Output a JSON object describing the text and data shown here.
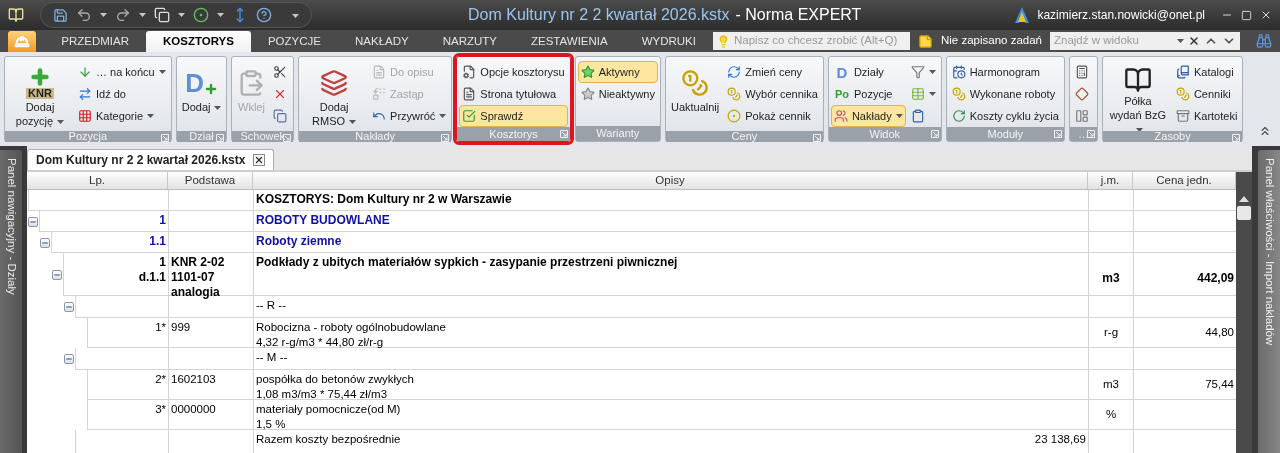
{
  "title_bar": {
    "document_name": "Dom Kultury nr 2 2 kwartał 2026.kstx",
    "app_name": "- Norma EXPERT",
    "user": "kazimierz.stan.nowicki@onet.pl"
  },
  "tabs": [
    {
      "label": "PRZEDMIAR",
      "selected": false
    },
    {
      "label": "KOSZTORYS",
      "selected": true
    },
    {
      "label": "POZYCJE",
      "selected": false
    },
    {
      "label": "NAKŁADY",
      "selected": false
    },
    {
      "label": "NARZUTY",
      "selected": false
    },
    {
      "label": "ZESTAWIENIA",
      "selected": false
    },
    {
      "label": "WYDRUKI",
      "selected": false
    }
  ],
  "tell_me": {
    "placeholder": "Napisz co chcesz zrobić (Alt+Q)"
  },
  "tasks": "Nie zapisano zadań",
  "find": {
    "placeholder": "Znajdź w widoku"
  },
  "ribbon": {
    "groups": [
      {
        "label": "Pozycja",
        "launcher": true,
        "highlighted": false,
        "items": [
          {
            "kind": "large",
            "label": "Dodaj pozycję",
            "icon_text": "KNR",
            "dropdown": true
          },
          {
            "kind": "small",
            "label": "… na końcu",
            "dropdown": true
          },
          {
            "kind": "small",
            "label": "Idź do",
            "dropdown": false
          },
          {
            "kind": "small",
            "label": "Kategorie",
            "dropdown": true
          }
        ]
      },
      {
        "label": "Dział",
        "launcher": true,
        "highlighted": false,
        "items": [
          {
            "kind": "large",
            "label": "Dodaj",
            "icon_text": "D",
            "dropdown": true
          }
        ]
      },
      {
        "label": "Schowek",
        "launcher": true,
        "highlighted": false,
        "items": [
          {
            "kind": "large",
            "label": "Wklej",
            "dropdown": false,
            "disabled": true
          },
          {
            "kind": "icon",
            "dropdown": false,
            "disabled": false
          },
          {
            "kind": "icon",
            "dropdown": false,
            "disabled": false
          },
          {
            "kind": "icon",
            "dropdown": false,
            "disabled": false
          }
        ]
      },
      {
        "label": "Nakłady",
        "launcher": true,
        "highlighted": false,
        "items": [
          {
            "kind": "large",
            "label": "Dodaj RMSO",
            "dropdown": true,
            "disabled": false
          },
          {
            "kind": "small",
            "label": "Do opisu",
            "dropdown": false,
            "disabled": true
          },
          {
            "kind": "small",
            "label": "Zastąp",
            "dropdown": false,
            "disabled": true
          },
          {
            "kind": "small",
            "label": "Przywróć",
            "dropdown": true,
            "disabled": false
          }
        ]
      },
      {
        "label": "Kosztorys",
        "launcher": true,
        "highlighted": true,
        "items": [
          {
            "kind": "small",
            "label": "Opcje kosztorysu",
            "dropdown": false,
            "active": false
          },
          {
            "kind": "small",
            "label": "Strona tytułowa",
            "dropdown": false,
            "active": false
          },
          {
            "kind": "small",
            "label": "Sprawdź",
            "dropdown": false,
            "active": true
          }
        ]
      },
      {
        "label": "Warianty",
        "launcher": false,
        "highlighted": false,
        "items": [
          {
            "kind": "small",
            "label": "Aktywny",
            "dropdown": false,
            "active": true
          },
          {
            "kind": "small",
            "label": "Nieaktywny",
            "dropdown": false,
            "active": false
          }
        ]
      },
      {
        "label": "Ceny",
        "launcher": true,
        "highlighted": false,
        "items": [
          {
            "kind": "large",
            "label": "Uaktualnij",
            "dropdown": false
          },
          {
            "kind": "small",
            "label": "Zmień ceny",
            "dropdown": false
          },
          {
            "kind": "small",
            "label": "Wybór cennika",
            "dropdown": false
          },
          {
            "kind": "small",
            "label": "Pokaż cennik",
            "dropdown": false
          }
        ]
      },
      {
        "label": "Widok",
        "launcher": true,
        "highlighted": false,
        "items": [
          {
            "kind": "small",
            "label": "Działy",
            "icon_text": "D",
            "dropdown": false,
            "active": false
          },
          {
            "kind": "small",
            "label": "Pozycje",
            "icon_text": "Po",
            "dropdown": false,
            "active": false
          },
          {
            "kind": "small",
            "label": "Nakłady",
            "dropdown": true,
            "active": true
          },
          {
            "kind": "icon",
            "dropdown": true,
            "active": false
          },
          {
            "kind": "icon",
            "dropdown": true,
            "active": false
          },
          {
            "kind": "icon",
            "dropdown": false,
            "active": false
          }
        ]
      },
      {
        "label": "Moduły",
        "launcher": true,
        "highlighted": false,
        "items": [
          {
            "kind": "small",
            "label": "Harmonogram",
            "dropdown": false
          },
          {
            "kind": "small",
            "label": "Wykonane roboty",
            "dropdown": false
          },
          {
            "kind": "small",
            "label": "Koszty cyklu życia",
            "dropdown": false
          }
        ]
      },
      {
        "label": "…",
        "launcher": true,
        "highlighted": false,
        "items": [
          {
            "kind": "icon",
            "dropdown": false
          },
          {
            "kind": "icon",
            "dropdown": false
          },
          {
            "kind": "icon",
            "dropdown": false
          }
        ]
      },
      {
        "label": "Zasoby",
        "launcher": true,
        "highlighted": false,
        "items": [
          {
            "kind": "large",
            "label": "Półka wydań BzG",
            "dropdown": true
          },
          {
            "kind": "small",
            "label": "Katalogi",
            "dropdown": false
          },
          {
            "kind": "small",
            "label": "Cenniki",
            "dropdown": false
          },
          {
            "kind": "small",
            "label": "Kartoteki",
            "dropdown": false
          }
        ]
      }
    ]
  },
  "document_tab": {
    "label": "Dom Kultury nr 2 2 kwartał 2026.kstx"
  },
  "side_panels": {
    "left": "Panel nawigacyjny - Działy",
    "right": "Panel właściwości - Import nakładów"
  },
  "table": {
    "columns": [
      "Lp.",
      "Podstawa",
      "Opisy",
      "j.m.",
      "Cena jedn."
    ],
    "rows": [
      {
        "kind": "header",
        "description": "KOSZTORYS: Dom Kultury nr 2 w Warszawie"
      },
      {
        "kind": "section",
        "lp": [
          "1"
        ],
        "description": "ROBOTY BUDOWLANE",
        "expanded": true,
        "children": [
          {
            "kind": "section",
            "lp": [
              "1.1"
            ],
            "description": "Roboty ziemne",
            "expanded": true,
            "children": [
              {
                "kind": "position",
                "lp": [
                  "1",
                  "d.1.1"
                ],
                "basis": [
                  "KNR 2-02",
                  "1101-07",
                  "analogia"
                ],
                "description": "Podkłady z ubitych materiałów sypkich - zasypanie przestrzeni piwnicznej",
                "unit": "m3",
                "price": "442,09",
                "expanded": true,
                "children": [
                  {
                    "kind": "group",
                    "description": "-- R --",
                    "expanded": true,
                    "children": [
                      {
                        "kind": "resource",
                        "lp": [
                          "1*"
                        ],
                        "basis": [
                          "999"
                        ],
                        "description": "Robocizna - roboty ogólnobudowlane",
                        "formula": "4,32 r-g/m3 * 44,80 zł/r-g",
                        "unit": "r-g",
                        "price": "44,80"
                      }
                    ]
                  },
                  {
                    "kind": "group",
                    "description": "-- M --",
                    "expanded": true,
                    "children": [
                      {
                        "kind": "resource",
                        "lp": [
                          "2*"
                        ],
                        "basis": [
                          "1602103"
                        ],
                        "description": "pospółka do betonów zwykłych",
                        "formula": "1,08 m3/m3 * 75,44 zł/m3",
                        "unit": "m3",
                        "price": "75,44"
                      },
                      {
                        "kind": "resource",
                        "lp": [
                          "3*"
                        ],
                        "basis": [
                          "0000000"
                        ],
                        "description": "materiały pomocnicze(od M)",
                        "formula": "1,5 %",
                        "unit": "%"
                      }
                    ]
                  },
                  {
                    "kind": "summary",
                    "description": "Razem koszty bezpośrednie",
                    "amount": "23 138,69"
                  }
                ]
              }
            ]
          }
        ]
      }
    ]
  }
}
